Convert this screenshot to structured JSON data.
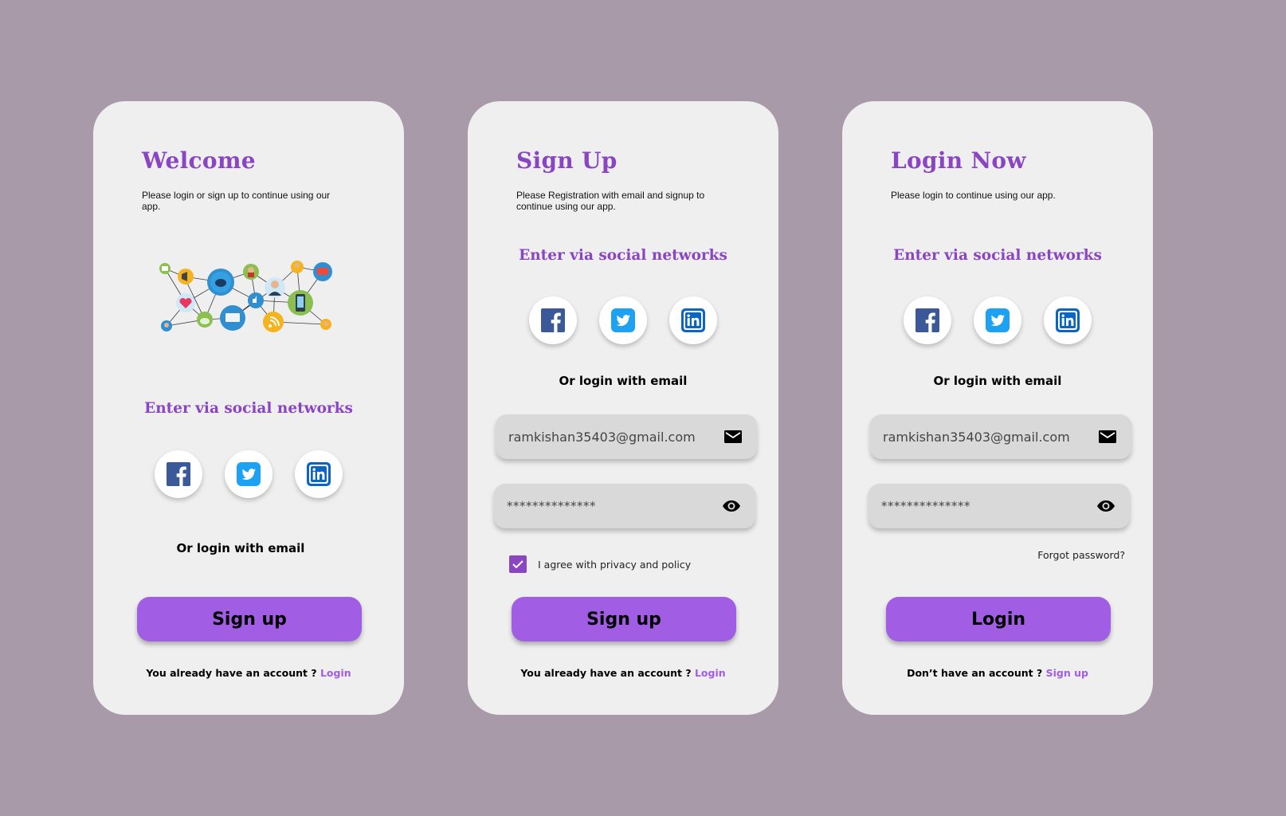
{
  "colors": {
    "background": "#a89aa9",
    "card": "#efefef",
    "accent_purple": "#8a45c2",
    "button_purple": "#a25de5",
    "field_gray": "#d9d9d9",
    "facebook": "#3b5998",
    "twitter": "#1da1f2",
    "linkedin": "#0a66c2"
  },
  "welcome": {
    "title": "Welcome",
    "subtitle": "Please login or sign up to continue using our app.",
    "social_heading": "Enter via social networks",
    "social_icons": [
      "facebook-icon",
      "twitter-icon",
      "linkedin-icon"
    ],
    "or_email": "Or login with email",
    "button_label": "Sign up",
    "footer_text": "You already have an account ?",
    "footer_link": "Login"
  },
  "signup": {
    "title": "Sign Up",
    "subtitle": "Please Registration with email and signup to continue using our app.",
    "social_heading": "Enter via social networks",
    "social_icons": [
      "facebook-icon",
      "twitter-icon",
      "linkedin-icon"
    ],
    "or_email": "Or login with email",
    "email_value": "ramkishan35403@gmail.com",
    "password_value": "**************",
    "agree_label": "I agree with privacy and policy",
    "agree_checked": true,
    "button_label": "Sign up",
    "footer_text": "You already have an account ?",
    "footer_link": "Login"
  },
  "login": {
    "title": "Login Now",
    "subtitle": "Please login to continue using our app.",
    "social_heading": "Enter via social networks",
    "social_icons": [
      "facebook-icon",
      "twitter-icon",
      "linkedin-icon"
    ],
    "or_email": "Or login with email",
    "email_value": "ramkishan35403@gmail.com",
    "password_value": "**************",
    "forgot_label": "Forgot password?",
    "button_label": "Login",
    "footer_text": "Don’t have an account ?",
    "footer_link": "Sign up"
  }
}
